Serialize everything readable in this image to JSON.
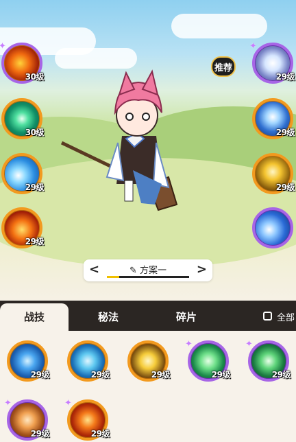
{
  "recommend_badge": "推荐",
  "left_skills": [
    {
      "level": "30级",
      "icon": "fire-swirl-icon",
      "border": "purple",
      "star": true
    },
    {
      "level": "30级",
      "icon": "green-vortex-icon",
      "border": "orange",
      "star": false
    },
    {
      "level": "29级",
      "icon": "ice-burst-icon",
      "border": "orange",
      "star": false
    },
    {
      "level": "29级",
      "icon": "fire-wave-icon",
      "border": "orange",
      "star": false
    }
  ],
  "right_skills": [
    {
      "level": "29级",
      "icon": "crystal-flower-icon",
      "border": "purple",
      "star": true
    },
    {
      "level": "29级",
      "icon": "ice-shard-icon",
      "border": "orange",
      "star": false
    },
    {
      "level": "29级",
      "icon": "gold-blade-icon",
      "border": "orange",
      "star": false
    },
    {
      "level": "",
      "icon": "blue-orb-icon",
      "border": "purple",
      "star": false
    }
  ],
  "plan": {
    "name": "方案一",
    "prev": "<",
    "next": ">",
    "progress": 0.15
  },
  "tabs": [
    {
      "label": "战技",
      "active": true
    },
    {
      "label": "秘法",
      "active": false
    },
    {
      "label": "碎片",
      "active": false
    }
  ],
  "select_all_label": "全部",
  "panel_skills": [
    {
      "level": "29级",
      "icon": "water-slash-icon",
      "border": "orange",
      "star": false
    },
    {
      "level": "29级",
      "icon": "blue-wind-icon",
      "border": "orange",
      "star": false
    },
    {
      "level": "29级",
      "icon": "golden-gate-icon",
      "border": "orange",
      "star": false
    },
    {
      "level": "29级",
      "icon": "green-claw-icon",
      "border": "purple",
      "star": true
    },
    {
      "level": "29级",
      "icon": "thorn-vine-icon",
      "border": "purple",
      "star": true
    },
    {
      "level": "29级",
      "icon": "flame-gem-icon",
      "border": "purple",
      "star": true
    },
    {
      "level": "29级",
      "icon": "fire-orb-icon",
      "border": "orange",
      "star": true
    }
  ],
  "colors": {
    "orange_ring": "#f29a1f",
    "purple_ring": "#a765e6",
    "tab_bar": "#2b2623",
    "panel_bg": "#f7f2ea"
  }
}
